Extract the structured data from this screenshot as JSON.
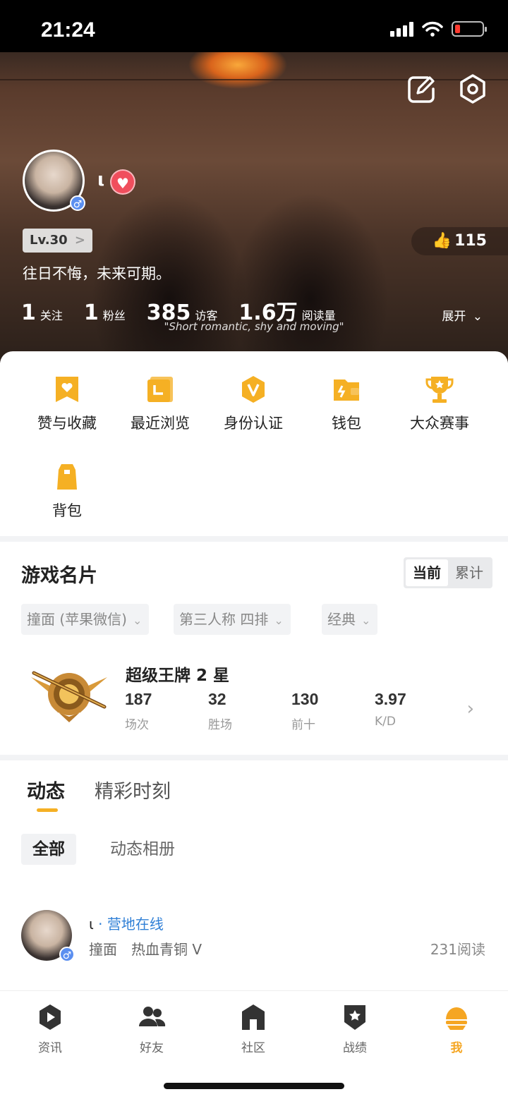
{
  "status_bar": {
    "time": "21:24"
  },
  "profile": {
    "username": "ι",
    "gender_symbol": "♂",
    "level": "Lv.30",
    "level_chevron": ">",
    "likes": "115",
    "bio": "往日不悔，未来可期。",
    "stats": [
      {
        "value": "1",
        "label": "关注"
      },
      {
        "value": "1",
        "label": "粉丝"
      },
      {
        "value": "385",
        "label": "访客"
      },
      {
        "value": "1.6万",
        "label": "阅读量"
      }
    ],
    "expand_label": "展开",
    "banner_subtitle": "\"Short romantic, shy and moving\""
  },
  "quick_actions": [
    {
      "label": "赞与收藏",
      "icon": "likes-favorites-icon"
    },
    {
      "label": "最近浏览",
      "icon": "recent-browse-icon"
    },
    {
      "label": "身份认证",
      "icon": "verification-icon"
    },
    {
      "label": "钱包",
      "icon": "wallet-icon"
    },
    {
      "label": "大众赛事",
      "icon": "trophy-icon"
    },
    {
      "label": "背包",
      "icon": "backpack-icon"
    }
  ],
  "game_card": {
    "title": "游戏名片",
    "segments": [
      "当前",
      "累计"
    ],
    "active_segment": "当前",
    "filters": [
      "撞面 (苹果微信)",
      "第三人称 四排",
      "经典"
    ],
    "rank_name": "超级王牌 2 星",
    "stats": [
      {
        "value": "187",
        "label": "场次"
      },
      {
        "value": "32",
        "label": "胜场"
      },
      {
        "value": "130",
        "label": "前十"
      },
      {
        "value": "3.97",
        "label": "K/D"
      }
    ]
  },
  "feed": {
    "tabs": [
      "动态",
      "精彩时刻"
    ],
    "chips": [
      "全部",
      "动态相册"
    ],
    "post": {
      "name": "ι",
      "status": "· 营地在线",
      "meta": "撞面　热血青铜 V",
      "reads": "231阅读"
    }
  },
  "tab_bar": [
    {
      "label": "资讯",
      "icon": "news-icon"
    },
    {
      "label": "好友",
      "icon": "friends-icon"
    },
    {
      "label": "社区",
      "icon": "community-icon"
    },
    {
      "label": "战绩",
      "icon": "record-icon"
    },
    {
      "label": "我",
      "icon": "me-icon",
      "active": true
    }
  ],
  "colors": {
    "accent": "#f5a623",
    "online": "#2f7fd6",
    "heart": "#f04e5d",
    "gender": "#5b8ff0"
  }
}
